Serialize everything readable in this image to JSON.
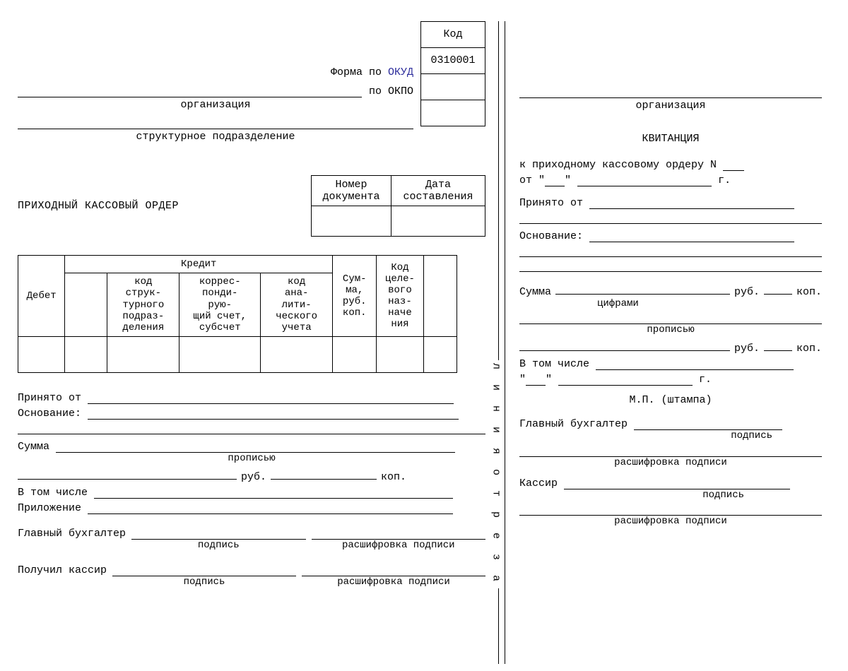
{
  "left": {
    "code_header": "Код",
    "form_label": "Форма по ",
    "okud_label": "ОКУД",
    "okud_code": "0310001",
    "okpo_label": "по ОКПО",
    "org_caption": "организация",
    "struct_caption": "структурное подразделение",
    "doc_title": "ПРИХОДНЫЙ КАССОВЫЙ ОРДЕР",
    "datebox": {
      "num": "Номер документа",
      "date": "Дата составления"
    },
    "table": {
      "debit": "Дебет",
      "credit": "Кредит",
      "sum": "Сум-\nма,\nруб.\nкоп.",
      "purpose": "Код\nцеле-\nвого\nназ-\nначе\nния",
      "sub_struct": "код\nструк-\nтурного\nподраз-\nделения",
      "sub_acct": "коррес-\nпонди-\nрую-\nщий счет,\nсубсчет",
      "sub_anal": "код\nана-\nлити-\nческого\nучета"
    },
    "received_from": "Принято от",
    "basis": "Основание:",
    "sum_label": "Сумма",
    "sum_caption": "прописью",
    "rub": "руб.",
    "kop": "коп.",
    "including": "В том числе",
    "attachment": "Приложение",
    "chief_acc": "Главный бухгалтер",
    "cashier_got": "Получил кассир",
    "sig_caption": "подпись",
    "sig_decode": "расшифровка подписи"
  },
  "cut_label": "л и н и я   о т р е з а",
  "right": {
    "org_caption": "организация",
    "title": "КВИТАНЦИЯ",
    "to_order": "к приходному кассовому ордеру N",
    "from": "от",
    "year_suffix": "г.",
    "received_from": "Принято от",
    "basis": "Основание:",
    "sum_label": "Сумма",
    "rub": "руб.",
    "kop": "коп.",
    "sum_digits": "цифрами",
    "sum_words": "прописью",
    "including": "В том числе",
    "stamp": "М.П. (штампа)",
    "chief_acc": "Главный бухгалтер",
    "cashier": "Кассир",
    "sig_caption": "подпись",
    "sig_decode": "расшифровка подписи"
  }
}
